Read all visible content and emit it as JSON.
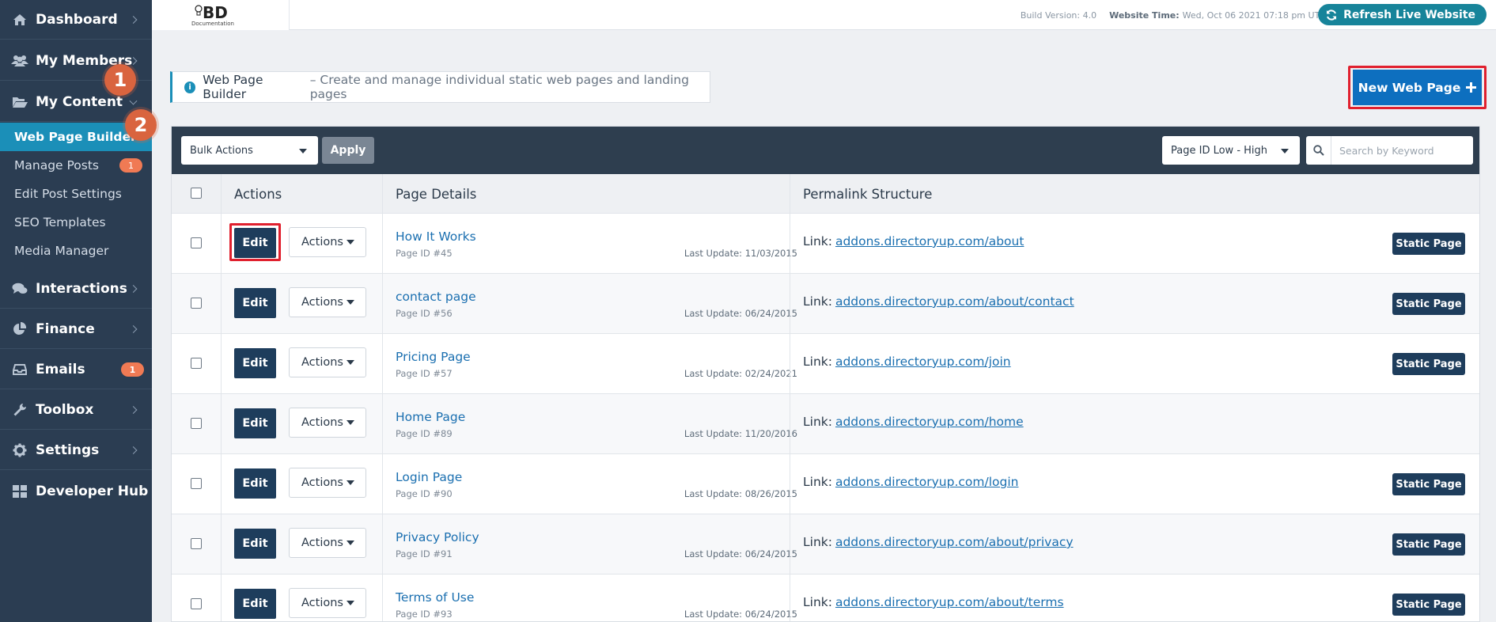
{
  "sidebar": {
    "items": [
      {
        "label": "Dashboard",
        "icon": "dashboard-icon"
      },
      {
        "label": "My Members",
        "icon": "users-icon"
      },
      {
        "label": "My Content",
        "icon": "folder-open-icon"
      },
      {
        "label": "Interactions",
        "icon": "chat-icon"
      },
      {
        "label": "Finance",
        "icon": "pie-chart-icon"
      },
      {
        "label": "Emails",
        "icon": "inbox-icon",
        "badge": "1"
      },
      {
        "label": "Toolbox",
        "icon": "wrench-icon"
      },
      {
        "label": "Settings",
        "icon": "gear-icon"
      },
      {
        "label": "Developer Hub",
        "icon": "grid-icon"
      }
    ],
    "sub_items": [
      {
        "label": "Web Page Builder",
        "active": true
      },
      {
        "label": "Manage Posts",
        "badge": "1"
      },
      {
        "label": "Edit Post Settings"
      },
      {
        "label": "SEO Templates"
      },
      {
        "label": "Media Manager"
      }
    ],
    "markers": [
      "1",
      "2"
    ]
  },
  "topbar": {
    "logo": "BD",
    "logo_sub": "Documentation",
    "build_version": "Build Version: 4.0",
    "website_time_label": "Website Time:",
    "website_time": "Wed, Oct 06 2021 07:18 pm UTC-07:00",
    "refresh_label": "Refresh Live Website"
  },
  "header": {
    "title": "Web Page Builder",
    "subtitle": "– Create and manage individual static web pages and landing pages",
    "new_page_label": "New Web Page"
  },
  "toolbar": {
    "bulk_actions": "Bulk Actions",
    "apply": "Apply",
    "sort": "Page ID Low - High",
    "search_placeholder": "Search by Keyword"
  },
  "table": {
    "columns": [
      "Actions",
      "Page Details",
      "Permalink Structure"
    ],
    "edit_label": "Edit",
    "actions_label": "Actions",
    "link_label": "Link:",
    "rows": [
      {
        "title": "How It Works",
        "page_id": "Page ID #45",
        "last_update": "Last Update: 11/03/2015",
        "link": "addons.directoryup.com/about",
        "badge": "Static Page"
      },
      {
        "title": "contact page",
        "page_id": "Page ID #56",
        "last_update": "Last Update: 06/24/2015",
        "link": "addons.directoryup.com/about/contact",
        "badge": "Static Page"
      },
      {
        "title": "Pricing Page",
        "page_id": "Page ID #57",
        "last_update": "Last Update: 02/24/2021",
        "link": "addons.directoryup.com/join",
        "badge": "Static Page"
      },
      {
        "title": "Home Page",
        "page_id": "Page ID #89",
        "last_update": "Last Update: 11/20/2016",
        "link": "addons.directoryup.com/home",
        "badge": ""
      },
      {
        "title": "Login Page",
        "page_id": "Page ID #90",
        "last_update": "Last Update: 08/26/2015",
        "link": "addons.directoryup.com/login",
        "badge": "Static Page"
      },
      {
        "title": "Privacy Policy",
        "page_id": "Page ID #91",
        "last_update": "Last Update: 06/24/2015",
        "link": "addons.directoryup.com/about/privacy",
        "badge": "Static Page"
      },
      {
        "title": "Terms of Use",
        "page_id": "Page ID #93",
        "last_update": "Last Update: 06/24/2015",
        "link": "addons.directoryup.com/about/terms",
        "badge": "Static Page"
      }
    ]
  },
  "colors": {
    "sidebar_bg": "#2b3d52",
    "active_item": "#1b8fb8",
    "primary_button": "#0d6fbf",
    "highlight": "#e0202e",
    "marker": "#d9643f"
  }
}
